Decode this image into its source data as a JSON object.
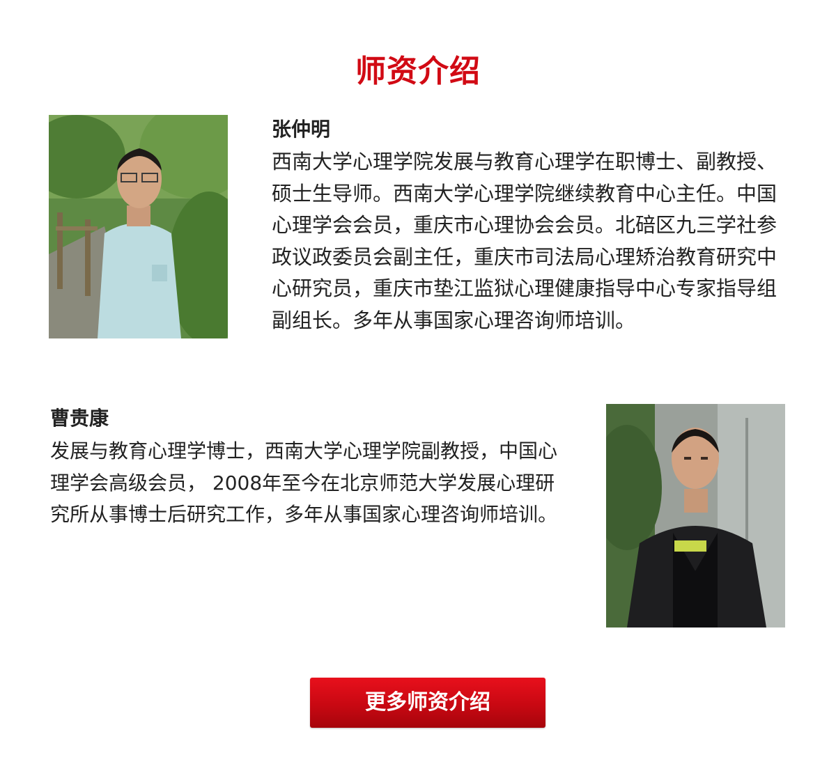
{
  "section": {
    "title": "师资介绍"
  },
  "teachers": [
    {
      "name": "张仲明",
      "bio": "西南大学心理学院发展与教育心理学在职博士、副教授、硕士生导师。西南大学心理学院继续教育中心主任。中国心理学会会员，重庆市心理协会会员。北碚区九三学社参政议政委员会副主任，重庆市司法局心理矫治教育研究中心研究员，重庆市垫江监狱心理健康指导中心专家指导组副组长。多年从事国家心理咨询师培训。"
    },
    {
      "name": "曹贵康",
      "bio": "发展与教育心理学博士，西南大学心理学院副教授，中国心理学会高级会员， 2008年至今在北京师范大学发展心理研究所从事博士后研究工作，多年从事国家心理咨询师培训。"
    }
  ],
  "more_button": {
    "label": "更多师资介绍"
  },
  "colors": {
    "accent": "#d10a14",
    "button": "#c80812",
    "text": "#222222"
  }
}
